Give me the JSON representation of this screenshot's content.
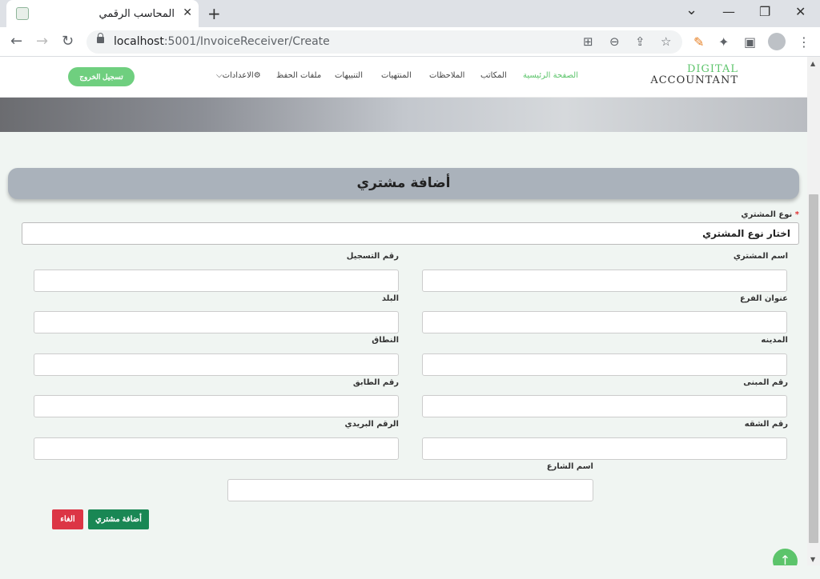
{
  "browser": {
    "tab_title": "المحاسب الرقمي",
    "tab_close": "✕",
    "new_tab": "+",
    "win_min": "—",
    "win_max": "❐",
    "win_close": "✕",
    "chevron": "⌄",
    "url_host": "localhost",
    "url_rest": ":5001/InvoiceReceiver/Create",
    "back": "←",
    "forward": "→",
    "reload": "↻",
    "zoom_icon": "⊖",
    "share_icon": "⇪",
    "star_icon": "☆",
    "translate_icon": "⊞",
    "puzzle_icon": "✦",
    "sidepanel_icon": "▣",
    "pen_icon": "✎",
    "menu_icon": "⋮"
  },
  "nav": {
    "logo_line1": "DIGITAL",
    "logo_line2": "ACCOUNTANT",
    "home": "الصفحة الرئيسية",
    "offices": "المكاتب",
    "notes": "الملاحظات",
    "expired": "المنتهيات",
    "alerts": "التنبيهات",
    "backups": "ملفات الحفظ",
    "settings": "⚙الاعدادات⌵",
    "logout": "تسجيل الخروج"
  },
  "form": {
    "title": "أضافة مشتري",
    "buyer_type_label": "نوع المشتري",
    "required_mark": "*",
    "buyer_type_value": "اختار نوع المشتري",
    "buyer_name_label": "اسم المشتري",
    "registration_label": "رقم التسجيل",
    "branch_label": "عنوان الفرع",
    "country_label": "البلد",
    "city_label": "المدينه",
    "region_label": "النطاق",
    "building_label": "رقم المبنى",
    "floor_label": "رقم الطابق",
    "apartment_label": "رقم الشقه",
    "postal_label": "الرقم البريدي",
    "street_label": "اسم الشارع",
    "add_button": "أضافة مشتري",
    "cancel_button": "الغاء"
  },
  "scroll_top_icon": "↑",
  "colors": {
    "accent_green": "#5cc46b",
    "button_green": "#198754",
    "button_red": "#dc3545",
    "header_gray": "#aab2bb"
  }
}
